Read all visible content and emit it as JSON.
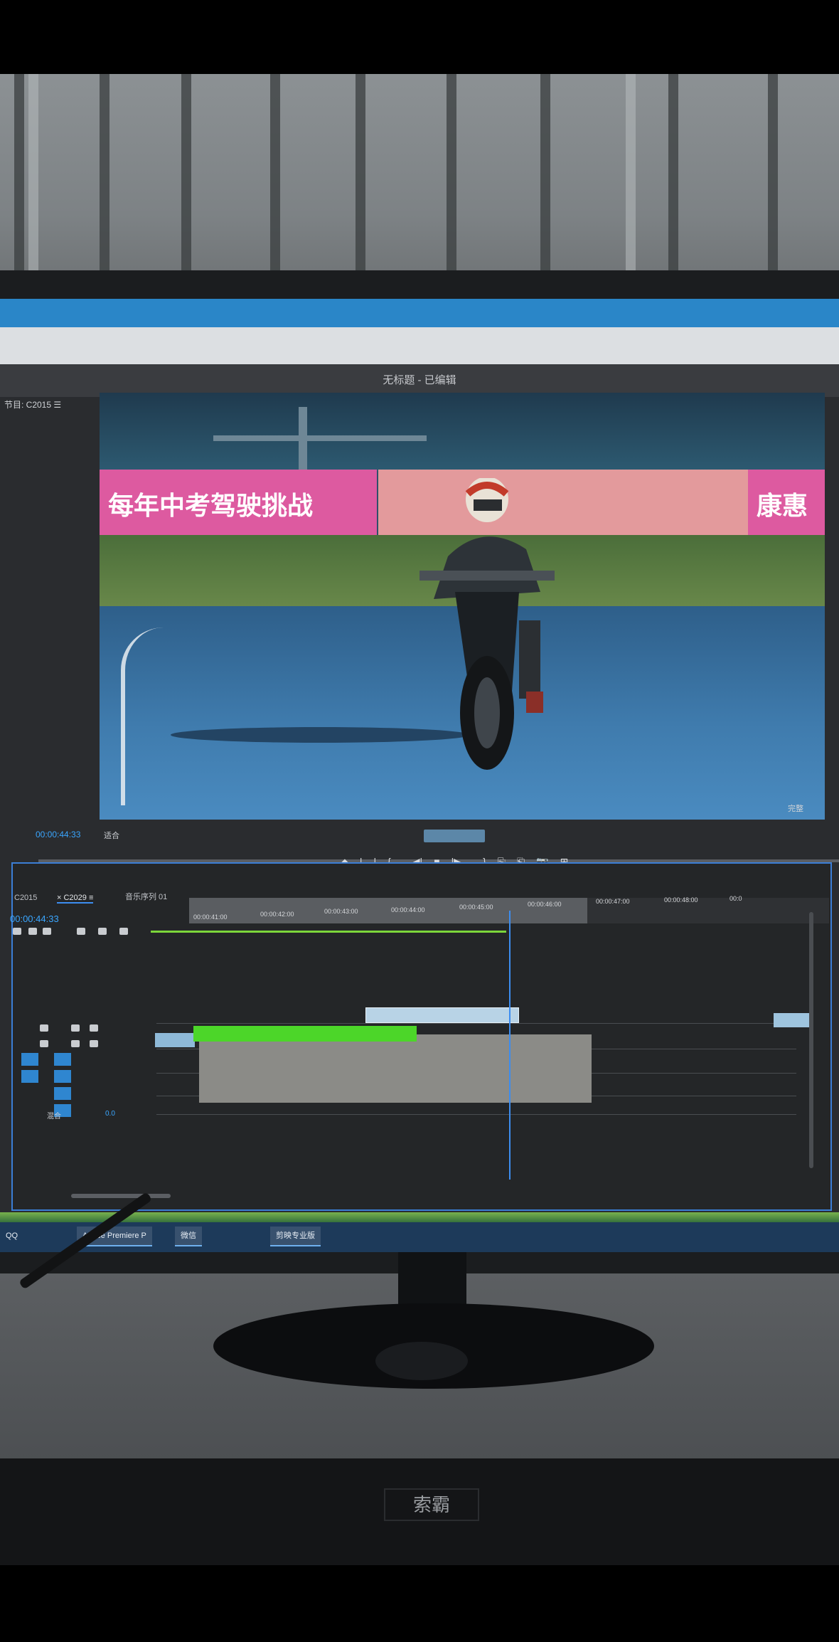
{
  "window": {
    "title": "无标题 - 已编辑"
  },
  "program_monitor": {
    "panel_label": "节目: C2015 ☰",
    "timecode": "00:00:44:33",
    "fit_label": "适合",
    "quality_label": "完整",
    "banner_text_left": "每年中考驾驶挑战",
    "banner_text_right": "康惠",
    "controls": [
      "⬥",
      "|",
      "|",
      "{←",
      "◀|",
      "■",
      "|▶",
      "→}",
      "⎘",
      "⎗",
      "📷",
      "⊞"
    ]
  },
  "timeline": {
    "tabs": [
      "C2015",
      "× C2029 ≡",
      "音乐序列 01"
    ],
    "timecode": "00:00:44:33",
    "ruler_labels": [
      "00:00:41:00",
      "00:00:42:00",
      "00:00:43:00",
      "00:00:44:00",
      "00:00:45:00",
      "00:00:46:00",
      "00:00:47:00",
      "00:00:48:00",
      "00:0"
    ],
    "track_label": "混合",
    "track_value": "0.0"
  },
  "taskbar": {
    "items": [
      "Adobe Premiere P",
      "微信",
      "剪映专业版"
    ],
    "left_label": "QQ"
  },
  "monitor_brand": "索霸",
  "colors": {
    "accent": "#3c8df0",
    "clip_green": "#4cd629",
    "clip_blue": "#b8d3e6",
    "taskbar": "#1d3a5a"
  }
}
